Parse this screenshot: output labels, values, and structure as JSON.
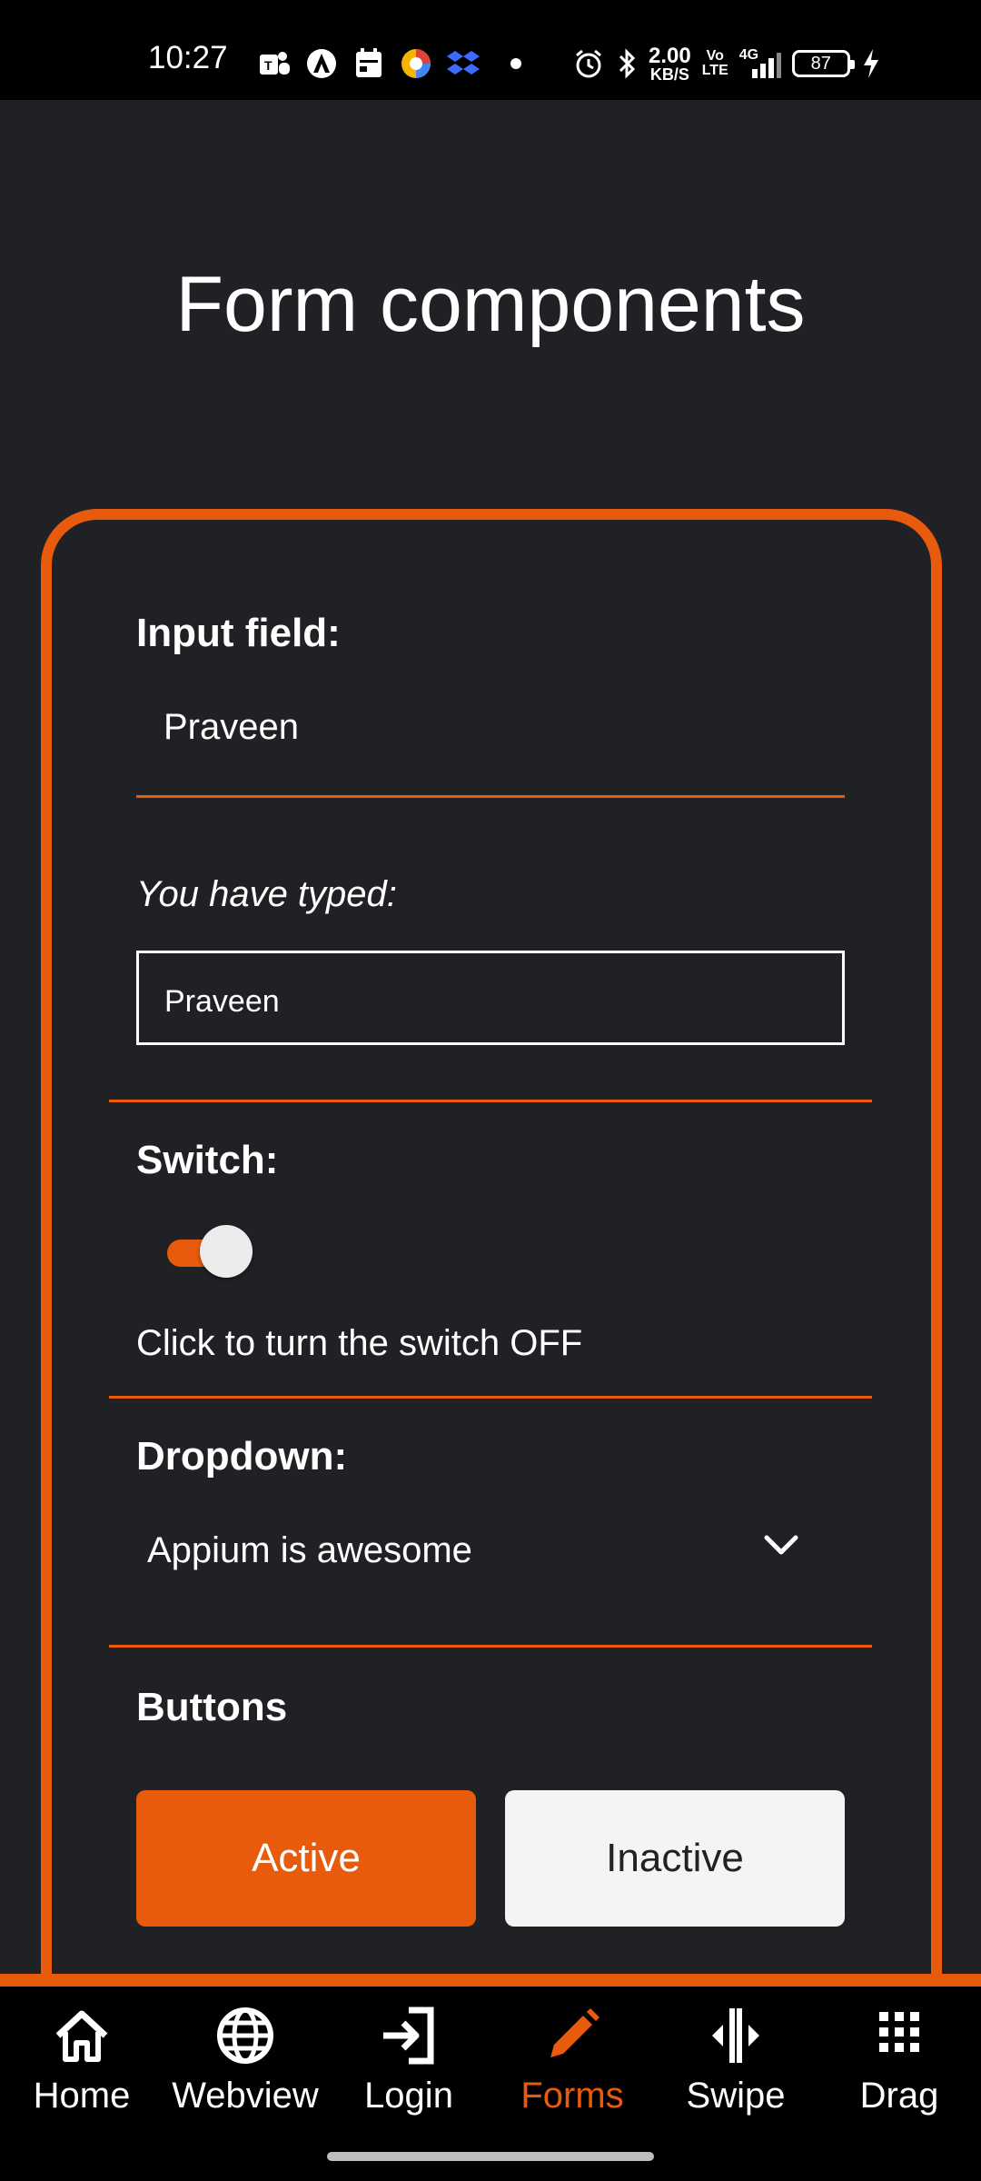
{
  "status_bar": {
    "time": "10:27",
    "net_speed_value": "2.00",
    "net_speed_unit": "KB/S",
    "volte_top": "Vo",
    "volte_bottom": "LTE",
    "network": "4G",
    "battery": "87"
  },
  "page": {
    "title": "Form components"
  },
  "form": {
    "input_label": "Input field:",
    "input_value": "Praveen",
    "typed_label": "You have typed:",
    "typed_value": "Praveen",
    "switch_label": "Switch:",
    "switch_on": true,
    "switch_text": "Click to turn the switch OFF",
    "dropdown_label": "Dropdown:",
    "dropdown_value": "Appium is awesome",
    "buttons_label": "Buttons",
    "active_button": "Active",
    "inactive_button": "Inactive"
  },
  "tabs": [
    {
      "label": "Home",
      "icon": "home-icon",
      "active": false
    },
    {
      "label": "Webview",
      "icon": "globe-icon",
      "active": false
    },
    {
      "label": "Login",
      "icon": "login-icon",
      "active": false
    },
    {
      "label": "Forms",
      "icon": "pencil-icon",
      "active": true
    },
    {
      "label": "Swipe",
      "icon": "swipe-icon",
      "active": false
    },
    {
      "label": "Drag",
      "icon": "grid-icon",
      "active": false
    }
  ],
  "colors": {
    "accent": "#e85a0c",
    "background": "#202124",
    "tab_bar": "#000000"
  }
}
